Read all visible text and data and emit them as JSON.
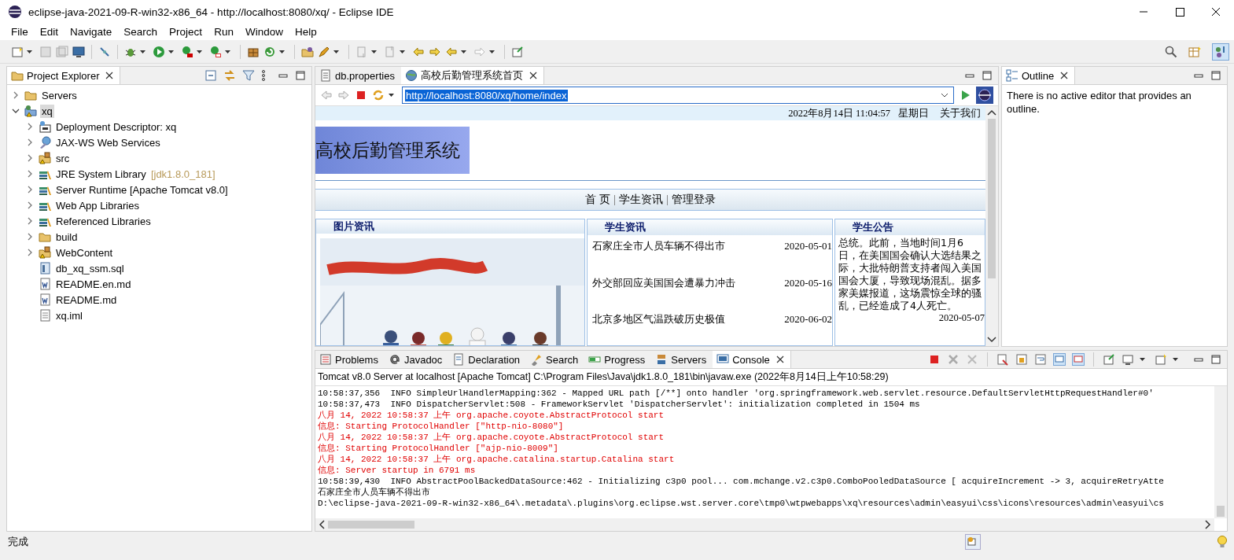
{
  "window": {
    "title": "eclipse-java-2021-09-R-win32-x86_64 - http://localhost:8080/xq/ - Eclipse IDE"
  },
  "menu": [
    "File",
    "Edit",
    "Navigate",
    "Search",
    "Project",
    "Run",
    "Window",
    "Help"
  ],
  "project_explorer": {
    "title": "Project Explorer",
    "tree": [
      {
        "label": "Servers",
        "kind": "folder",
        "expanded": false,
        "selected": false
      },
      {
        "label": "xq",
        "kind": "project",
        "expanded": true,
        "selected": true,
        "children": [
          {
            "label": "Deployment Descriptor: xq",
            "kind": "descriptor",
            "expanded": false,
            "selected": false
          },
          {
            "label": "JAX-WS Web Services",
            "kind": "webservice",
            "expanded": false,
            "selected": false
          },
          {
            "label": "src",
            "kind": "package",
            "expanded": false,
            "selected": false
          },
          {
            "label": "JRE System Library",
            "suffix": "[jdk1.8.0_181]",
            "kind": "library",
            "expanded": false,
            "selected": false
          },
          {
            "label": "Server Runtime [Apache Tomcat v8.0]",
            "kind": "library",
            "expanded": false,
            "selected": false
          },
          {
            "label": "Web App Libraries",
            "kind": "library",
            "expanded": false,
            "selected": false
          },
          {
            "label": "Referenced Libraries",
            "kind": "library",
            "expanded": false,
            "selected": false
          },
          {
            "label": "build",
            "kind": "folder",
            "expanded": false,
            "selected": false
          },
          {
            "label": "WebContent",
            "kind": "package",
            "expanded": false,
            "selected": false
          },
          {
            "label": "db_xq_ssm.sql",
            "kind": "sql",
            "selected": false
          },
          {
            "label": "README.en.md",
            "kind": "doc",
            "selected": false
          },
          {
            "label": "README.md",
            "kind": "doc",
            "selected": false
          },
          {
            "label": "xq.iml",
            "kind": "text",
            "selected": false
          }
        ]
      }
    ]
  },
  "editor": {
    "tabs": [
      {
        "label": "db.properties",
        "kind": "file",
        "selected": false
      },
      {
        "label": "高校后勤管理系统首页",
        "kind": "web",
        "selected": true
      }
    ],
    "url": "http://localhost:8080/xq/home/index",
    "page": {
      "datetime": "2022年8月14日 11:04:57",
      "weekday": "星期日",
      "about": "关于我们",
      "banner": "高校后勤管理系统",
      "nav": [
        "首 页",
        "学生资讯",
        "管理登录"
      ],
      "photo_panel": {
        "title": "图片资讯"
      },
      "news_panel": {
        "title": "学生资讯",
        "rows": [
          {
            "title": "石家庄全市人员车辆不得出市",
            "date": "2020-05-01"
          },
          {
            "title": "外交部回应美国国会遭暴力冲击",
            "date": "2020-05-16"
          },
          {
            "title": "北京多地区气温跌破历史极值",
            "date": "2020-06-02"
          }
        ]
      },
      "notice_panel": {
        "title": "学生公告",
        "text": "总统。此前，当地时间1月6日，在美国国会确认大选结果之际，大批特朗普支持者闯入美国国会大厦，导致现场混乱。据多家美媒报道，这场震惊全球的骚乱，已经造成了4人死亡。",
        "date": "2020-05-07"
      }
    }
  },
  "outline": {
    "title": "Outline",
    "message": "There is no active editor that provides an outline."
  },
  "console": {
    "tabs": [
      {
        "label": "Problems",
        "kind": "problems",
        "selected": false
      },
      {
        "label": "Javadoc",
        "kind": "javadoc",
        "selected": false
      },
      {
        "label": "Declaration",
        "kind": "declaration",
        "selected": false
      },
      {
        "label": "Search",
        "kind": "search",
        "selected": false
      },
      {
        "label": "Progress",
        "kind": "progress",
        "selected": false
      },
      {
        "label": "Servers",
        "kind": "servers",
        "selected": false
      },
      {
        "label": "Console",
        "kind": "console",
        "selected": true
      }
    ],
    "header": "Tomcat v8.0 Server at localhost [Apache Tomcat] C:\\Program Files\\Java\\jdk1.8.0_181\\bin\\javaw.exe  (2022年8月14日上午10:58:29)",
    "lines": [
      {
        "text": "10:58:37,356  INFO SimpleUrlHandlerMapping:362 - Mapped URL path [/**] onto handler 'org.springframework.web.servlet.resource.DefaultServletHttpRequestHandler#0'",
        "kind": "out"
      },
      {
        "text": "10:58:37,473  INFO DispatcherServlet:508 - FrameworkServlet 'DispatcherServlet': initialization completed in 1504 ms",
        "kind": "out"
      },
      {
        "text": "八月 14, 2022 10:58:37 上午 org.apache.coyote.AbstractProtocol start",
        "kind": "err"
      },
      {
        "text": "信息: Starting ProtocolHandler [\"http-nio-8080\"]",
        "kind": "err"
      },
      {
        "text": "八月 14, 2022 10:58:37 上午 org.apache.coyote.AbstractProtocol start",
        "kind": "err"
      },
      {
        "text": "信息: Starting ProtocolHandler [\"ajp-nio-8009\"]",
        "kind": "err"
      },
      {
        "text": "八月 14, 2022 10:58:37 上午 org.apache.catalina.startup.Catalina start",
        "kind": "err"
      },
      {
        "text": "信息: Server startup in 6791 ms",
        "kind": "err"
      },
      {
        "text": "10:58:39,430  INFO AbstractPoolBackedDataSource:462 - Initializing c3p0 pool... com.mchange.v2.c3p0.ComboPooledDataSource [ acquireIncrement -> 3, acquireRetryAtte",
        "kind": "out"
      },
      {
        "text": "石家庄全市人员车辆不得出市",
        "kind": "out"
      },
      {
        "text": "D:\\eclipse-java-2021-09-R-win32-x86_64\\.metadata\\.plugins\\org.eclipse.wst.server.core\\tmp0\\wtpwebapps\\xq\\resources\\admin\\easyui\\css\\icons\\resources\\admin\\easyui\\cs",
        "kind": "out"
      }
    ]
  },
  "status_bar": {
    "text": "完成"
  }
}
